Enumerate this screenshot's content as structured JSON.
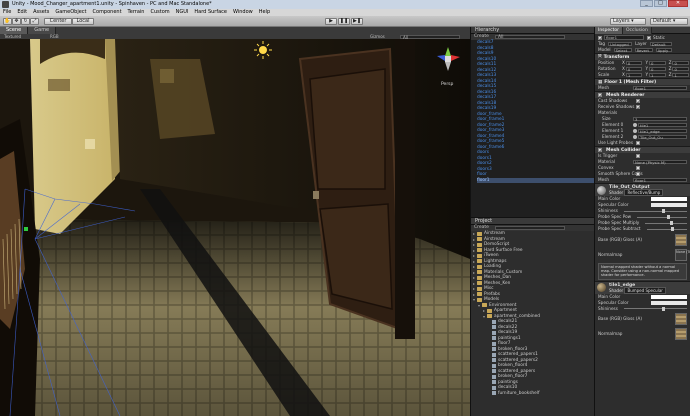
{
  "window": {
    "title": "Unity - Mood_Changer_apartment1.unity - Spinhaven - PC and Mac Standalone*",
    "controls": [
      "_",
      "□",
      "✕"
    ]
  },
  "menu": [
    "File",
    "Edit",
    "Assets",
    "GameObject",
    "Component",
    "Terrain",
    "Custom",
    "NGUI",
    "Hard Surface",
    "Window",
    "Help"
  ],
  "toolbar": {
    "pivot_label": "Center",
    "space_label": "Local",
    "layers_label": "Layers",
    "layout_label": "Default"
  },
  "scene": {
    "tabs": [
      "Scene",
      "Game"
    ],
    "shading_mode": "Textured",
    "render_mode": "RGB",
    "gizmos_label": "Gizmos",
    "search_placeholder": "All",
    "persp_label": "Persp"
  },
  "hierarchy": {
    "tab": "Hierarchy",
    "create_label": "Create",
    "search_placeholder": "All",
    "items": [
      "decals7",
      "decals8",
      "decals9",
      "decals10",
      "decals11",
      "decals12",
      "decals13",
      "decals14",
      "decals15",
      "decals16",
      "decals17",
      "decals18",
      "decals19",
      "door_frame",
      "door_frame1",
      "door_frame2",
      "door_frame3",
      "door_frame4",
      "door_frame5",
      "door_frame6",
      "doors",
      "doors1",
      "doors2",
      "doors3",
      "floor",
      "floor1"
    ],
    "selected_index": 25
  },
  "project": {
    "tab": "Project",
    "create_label": "Create",
    "search_placeholder": "",
    "items": [
      {
        "name": "Airstream",
        "kind": "folder",
        "indent": 0
      },
      {
        "name": "Airstream",
        "kind": "folder",
        "indent": 0
      },
      {
        "name": "DemoScript",
        "kind": "folder",
        "indent": 0
      },
      {
        "name": "Hard Surface Free",
        "kind": "folder",
        "indent": 0
      },
      {
        "name": "iTween",
        "kind": "folder",
        "indent": 0
      },
      {
        "name": "Lightmaps",
        "kind": "folder",
        "indent": 0
      },
      {
        "name": "Loading",
        "kind": "folder",
        "indent": 0
      },
      {
        "name": "Materials_Custom",
        "kind": "folder",
        "indent": 0
      },
      {
        "name": "Meshes_Dan",
        "kind": "folder",
        "indent": 0
      },
      {
        "name": "Meshes_Ken",
        "kind": "folder",
        "indent": 0
      },
      {
        "name": "Misc",
        "kind": "folder",
        "indent": 0
      },
      {
        "name": "Prefabs",
        "kind": "folder",
        "indent": 0
      },
      {
        "name": "Models",
        "kind": "folder-open",
        "indent": 0
      },
      {
        "name": "Environment",
        "kind": "folder-open",
        "indent": 1
      },
      {
        "name": "Apartment",
        "kind": "folder",
        "indent": 2
      },
      {
        "name": "apartment_combined",
        "kind": "folder-open",
        "indent": 2
      },
      {
        "name": "decals21",
        "kind": "file",
        "indent": 3
      },
      {
        "name": "decals22",
        "kind": "file",
        "indent": 3
      },
      {
        "name": "decals19",
        "kind": "file",
        "indent": 3
      },
      {
        "name": "paintings1",
        "kind": "file",
        "indent": 3
      },
      {
        "name": "floor7",
        "kind": "file",
        "indent": 3
      },
      {
        "name": "broken_floor3",
        "kind": "file",
        "indent": 3
      },
      {
        "name": "scattered_papers1",
        "kind": "file",
        "indent": 3
      },
      {
        "name": "scattered_papers2",
        "kind": "file",
        "indent": 3
      },
      {
        "name": "broken_floor4",
        "kind": "file",
        "indent": 3
      },
      {
        "name": "scattered_papers",
        "kind": "file",
        "indent": 3
      },
      {
        "name": "broken_floor7",
        "kind": "file",
        "indent": 3
      },
      {
        "name": "paintings",
        "kind": "file",
        "indent": 3
      },
      {
        "name": "decals10",
        "kind": "file",
        "indent": 3
      },
      {
        "name": "furniture_bookshelf",
        "kind": "file",
        "indent": 3
      }
    ]
  },
  "inspector": {
    "tabs": [
      "Inspector",
      "Occlusion"
    ],
    "object_name": "floor1",
    "static_label": "Static",
    "tag_label": "Tag",
    "tag_value": "Untagged",
    "layer_label": "Layer",
    "layer_value": "Default",
    "model_label": "Model",
    "select_label": "Select",
    "revert_label": "Revert",
    "apply_label": "Apply",
    "transform": {
      "title": "Transform",
      "rows": [
        {
          "label": "Position",
          "x": "0",
          "y": "0",
          "z": "0"
        },
        {
          "label": "Rotation",
          "x": "0",
          "y": "0",
          "z": "0"
        },
        {
          "label": "Scale",
          "x": "1",
          "y": "1",
          "z": "1"
        }
      ]
    },
    "mesh_filter": {
      "title": "Floor 1 (Mesh Filter)",
      "mesh_label": "Mesh",
      "mesh_value": "floor1"
    },
    "mesh_renderer": {
      "title": "Mesh Renderer",
      "cast_shadows": "Cast Shadows",
      "receive_shadows": "Receive Shadows",
      "materials": "Materials",
      "size_label": "Size",
      "size_value": "3",
      "elements": [
        {
          "label": "Element 0",
          "value": "tile1"
        },
        {
          "label": "Element 1",
          "value": "tile1_edge"
        },
        {
          "label": "Element 2",
          "value": "Tile_Out_Ou"
        }
      ],
      "use_light_probes": "Use Light Probes"
    },
    "mesh_collider": {
      "title": "Mesh Collider",
      "is_trigger": "Is Trigger",
      "material_label": "Material",
      "material_value": "None (Physic M)",
      "convex": "Convex",
      "smooth": "Smooth Sphere Collis",
      "mesh_label": "Mesh",
      "mesh_value": "floor1"
    },
    "material1": {
      "name": "Tile_Out_Output",
      "shader_label": "Shader",
      "shader_value": "Reflective/Bump",
      "rows": [
        "Main Color",
        "Specular Color",
        "Shininess",
        "Probe Spec Pow",
        "Probe Spec Multiply",
        "Probe Spec Subtract",
        "Base (RGB) Gloss (A)",
        "Normalmap"
      ],
      "tiling_label": "Tiling",
      "offset_label": "Offset",
      "select_label": "Select",
      "none_texture": "None (Texture)",
      "warning": "Normal mapped shader without a normal map. Consider using a non-normal mapped shader for performance."
    },
    "material2": {
      "name": "tile1_edge",
      "shader_label": "Shader",
      "shader_value": "Bumped Specular",
      "rows": [
        "Main Color",
        "Specular Color",
        "Shininess",
        "Base (RGB) Gloss (A)",
        "Normalmap"
      ]
    }
  }
}
